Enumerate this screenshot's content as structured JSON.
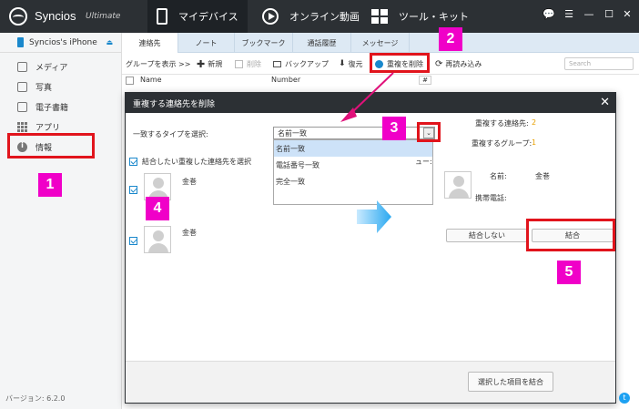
{
  "app": {
    "name": "Syncios",
    "edition": "Ultimate"
  },
  "main_tabs": [
    {
      "label": "マイデバイス",
      "icon": "phone-icon"
    },
    {
      "label": "オンライン動画",
      "icon": "play-icon"
    },
    {
      "label": "ツール・キット",
      "icon": "toolkit-icon"
    }
  ],
  "window_controls": {
    "message": "💬",
    "menu": "☰",
    "minimize": "—",
    "maximize": "☐",
    "close": "✕"
  },
  "sidebar": {
    "device": "Syncios's iPhone",
    "eject": "⏏",
    "items": [
      {
        "label": "メディア",
        "icon": "media-icon"
      },
      {
        "label": "写真",
        "icon": "photo-icon"
      },
      {
        "label": "電子書籍",
        "icon": "ebook-icon"
      },
      {
        "label": "アプリ",
        "icon": "apps-icon"
      },
      {
        "label": "情報",
        "icon": "info-icon"
      }
    ],
    "version": "バージョン: 6.2.0"
  },
  "sub_tabs": [
    "連絡先",
    "ノート",
    "ブックマーク",
    "通話履歴",
    "メッセージ"
  ],
  "toolbar": {
    "show_group": "グループを表示 >>",
    "new": "新規",
    "delete": "削除",
    "backup": "バックアップ",
    "restore": "復元",
    "dedupe": "重複を削除",
    "reload": "再読み込み",
    "search_placeholder": "Search"
  },
  "columns": {
    "name": "Name",
    "number": "Number",
    "index": "#"
  },
  "dialog": {
    "title": "重複する連絡先を削除",
    "match_label": "一致するタイプを選択:",
    "selected": "名前一致",
    "options": [
      "名前一致",
      "電話番号一致",
      "完全一致"
    ],
    "dup_contacts_label": "重複する連絡先:",
    "dup_contacts_value": "2",
    "dup_groups_label": "重複するグループ:",
    "dup_groups_value": "1",
    "select_all": "結合したい重複した連絡先を選択",
    "preview_label": "ュー:",
    "contacts": [
      {
        "name": "金巻"
      },
      {
        "name": "金巻"
      }
    ],
    "preview": {
      "name_label": "名前:",
      "name_value": "金巻",
      "phone_label": "携帯電話:"
    },
    "no_merge": "結合しない",
    "merge": "結合",
    "merge_selected": "選択した項目を結合"
  },
  "annotations": [
    "1",
    "2",
    "3",
    "4",
    "5"
  ],
  "colors": {
    "titlebar": "#2c3034",
    "accent": "#1a88cc",
    "marker": "#f000c8",
    "highlight": "#e1141c"
  }
}
